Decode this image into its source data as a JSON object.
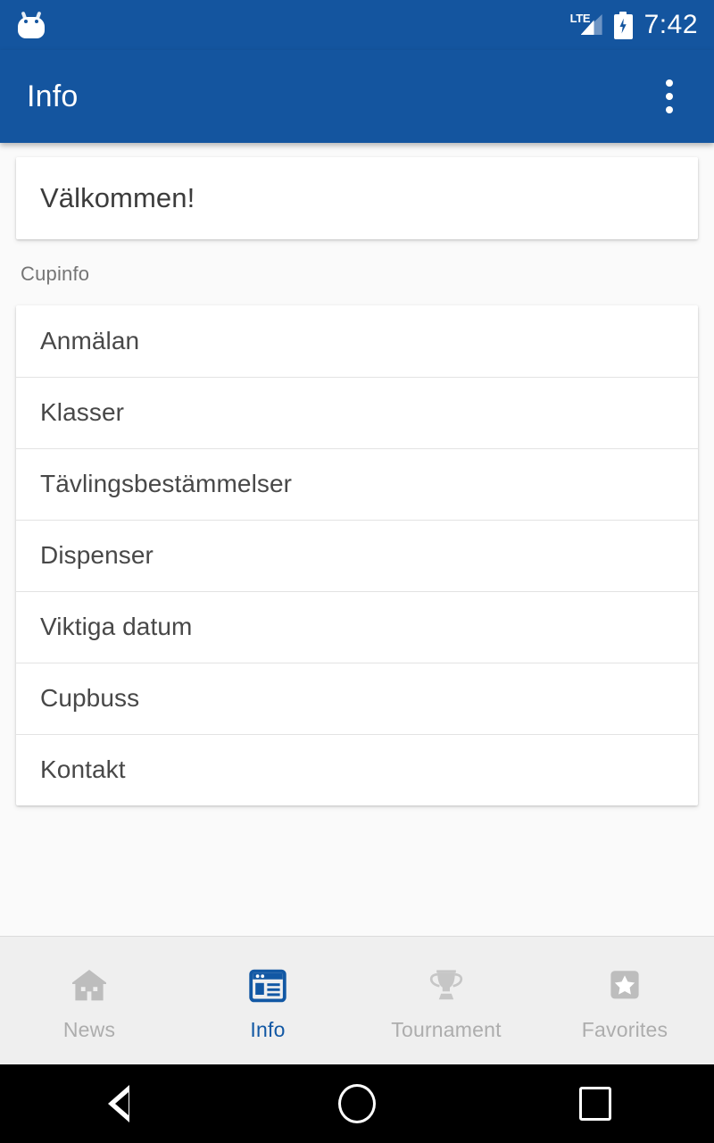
{
  "statusbar": {
    "notification_icon": "android-head-icon",
    "network_type": "LTE",
    "signal_icon": "signal-bars-icon",
    "battery_icon": "battery-charging-icon",
    "time": "7:42"
  },
  "appbar": {
    "title": "Info",
    "overflow_icon": "overflow-menu-icon"
  },
  "content": {
    "welcome": "Välkommen!",
    "section_label": "Cupinfo",
    "items": [
      {
        "label": "Anmälan"
      },
      {
        "label": "Klasser"
      },
      {
        "label": "Tävlingsbestämmelser"
      },
      {
        "label": "Dispenser"
      },
      {
        "label": "Viktiga datum"
      },
      {
        "label": "Cupbuss"
      },
      {
        "label": "Kontakt"
      }
    ]
  },
  "bottomnav": {
    "active_index": 1,
    "tabs": [
      {
        "label": "News",
        "icon": "home-icon"
      },
      {
        "label": "Info",
        "icon": "web-page-icon"
      },
      {
        "label": "Tournament",
        "icon": "trophy-icon"
      },
      {
        "label": "Favorites",
        "icon": "star-icon"
      }
    ]
  },
  "sysnav": {
    "back": "back-icon",
    "home": "home-circle-icon",
    "recents": "recents-square-icon"
  },
  "colors": {
    "primary": "#14559F",
    "accent": "#1258A4",
    "background": "#FAFAFA",
    "card": "#FFFFFF",
    "inactive": "#BDBDBD",
    "divider": "#E3E3E3"
  }
}
